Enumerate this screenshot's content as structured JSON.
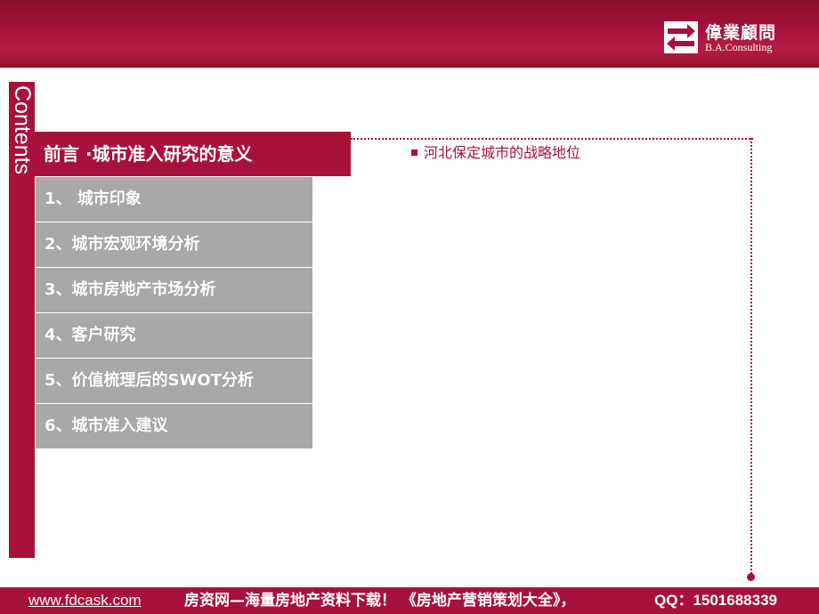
{
  "header": {
    "logo_cn": "偉業顧問",
    "logo_en": "B.A.Consulting",
    "brand_color": "#a8123a"
  },
  "sidebar": {
    "vertical_title": "Contents",
    "active_item": "前言 ·城市准入研究的意义",
    "items": [
      {
        "label": "1、 城市印象"
      },
      {
        "label": "2、城市宏观环境分析"
      },
      {
        "label": "3、城市房地产市场分析"
      },
      {
        "label": "4、客户研究"
      },
      {
        "label": "5、价值梳理后的SWOT分析"
      },
      {
        "label": "6、城市准入建议"
      }
    ]
  },
  "content": {
    "bullet": "河北保定城市的战略地位"
  },
  "footer": {
    "link": "www.fdcask.com",
    "text": "房资网—海量房地产资料下载！ 《房地产营销策划大全》，",
    "qq": "QQ：1501688339"
  },
  "icons": [
    "logo-arrows-icon",
    "bullet-square-icon"
  ]
}
